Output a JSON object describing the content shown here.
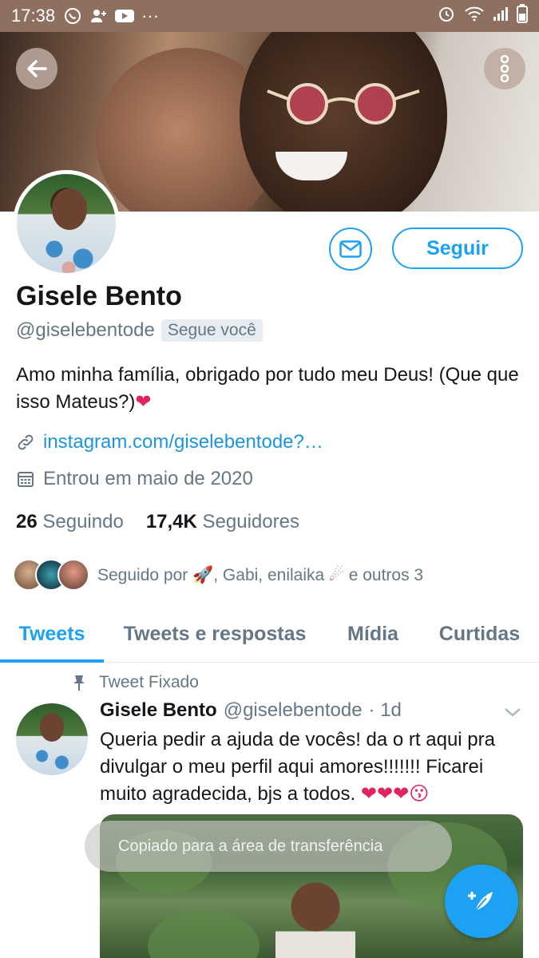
{
  "status_bar": {
    "time": "17:38",
    "overflow": "···",
    "icons": [
      "whatsapp-icon",
      "person-add-icon",
      "youtube-icon",
      "alarm-icon",
      "wifi-icon",
      "signal-icon",
      "battery-icon"
    ]
  },
  "profile": {
    "name": "Gisele Bento",
    "handle": "@giselebentode",
    "follows_you": "Segue você",
    "bio": "Amo minha família, obrigado por tudo meu Deus! (Que que isso Mateus?)",
    "bio_emoji": "❤",
    "link": "instagram.com/giselebentode?…",
    "joined": "Entrou em maio de 2020",
    "following_count": "26",
    "following_label": "Seguindo",
    "followers_count": "17,4K",
    "followers_label": "Seguidores",
    "followed_by_prefix": "Seguido por",
    "followed_by_emoji1": "🚀",
    "followed_by_names": ", Gabi, enilaika",
    "followed_by_emoji2": "☄",
    "followed_by_suffix": "e outros 3",
    "follow_button": "Seguir"
  },
  "tabs": [
    {
      "label": "Tweets",
      "active": true
    },
    {
      "label": "Tweets e respostas",
      "active": false
    },
    {
      "label": "Mídia",
      "active": false
    },
    {
      "label": "Curtidas",
      "active": false
    }
  ],
  "tweet": {
    "pinned_label": "Tweet Fixado",
    "name": "Gisele Bento",
    "handle": "@giselebentode",
    "time": "· 1d",
    "text": "Queria pedir a ajuda de vocês! da o rt aqui pra divulgar o meu perfil aqui amores!!!!!!! Ficarei muito  agradecida, bjs a todos.",
    "emojis": "❤❤❤😗"
  },
  "toast": "Copiado para a área de transferência",
  "colors": {
    "accent": "#1da1f2",
    "link": "#1b95e0",
    "secondary_text": "#657786",
    "status_bar": "#8d7060",
    "heart": "#e0245e"
  }
}
